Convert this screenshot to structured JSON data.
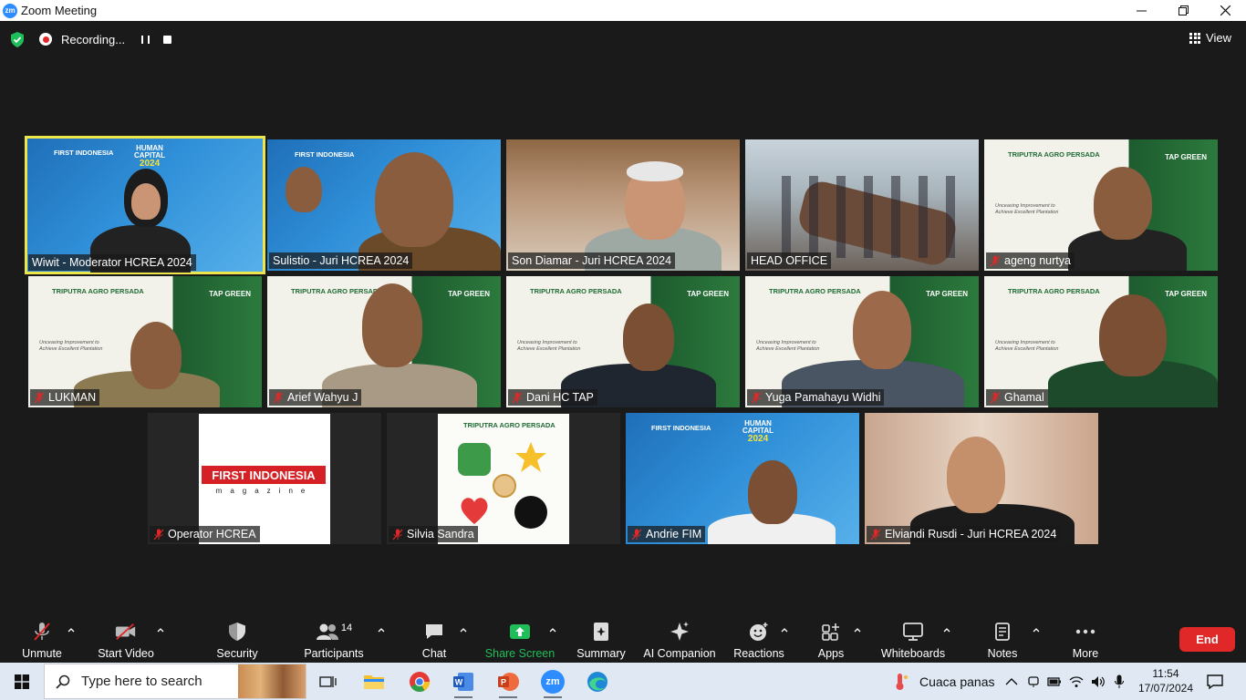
{
  "window": {
    "title": "Zoom Meeting",
    "logo_text": "zm",
    "controls": [
      "minimize-icon",
      "restore-icon",
      "close-icon"
    ]
  },
  "topbar": {
    "recording_label": "Recording...",
    "view_label": "View"
  },
  "participants": [
    {
      "name": "Wiwit - Moderator HCREA 2024",
      "muted": false,
      "active_speaker": true,
      "background": "human-capital-2024"
    },
    {
      "name": "Sulistio - Juri HCREA 2024",
      "muted": false,
      "background": "human-capital-2024"
    },
    {
      "name": "Son Diamar - Juri HCREA 2024",
      "muted": false,
      "background": "office"
    },
    {
      "name": "HEAD OFFICE",
      "muted": false,
      "background": "meeting-room"
    },
    {
      "name": "ageng nurtya",
      "muted": true,
      "background": "tap-green"
    },
    {
      "name": "LUKMAN",
      "muted": true,
      "background": "tap-green"
    },
    {
      "name": "Arief Wahyu J",
      "muted": true,
      "background": "tap-green"
    },
    {
      "name": "Dani HC TAP",
      "muted": true,
      "background": "tap-green"
    },
    {
      "name": "Yuga Pamahayu Widhi",
      "muted": true,
      "background": "tap-green"
    },
    {
      "name": "Ghamal",
      "muted": true,
      "background": "tap-green"
    },
    {
      "name": "Operator HCREA",
      "muted": true,
      "background": "first-indonesia-logo"
    },
    {
      "name": "Silvia Sandra",
      "muted": true,
      "background": "triputra-mascots"
    },
    {
      "name": "Andrie FIM",
      "muted": true,
      "background": "human-capital-2024"
    },
    {
      "name": "Elviandi Rusdi - Juri HCREA 2024",
      "muted": true,
      "background": "beige-room"
    }
  ],
  "backgrounds": {
    "hc_brand": "FIRST INDONESIA",
    "hc_logo_line1": "HUMAN",
    "hc_logo_line2": "CAPITAL",
    "hc_logo_year": "2024",
    "tap_brand": "TRIPUTRA AGRO PERSADA",
    "tap_green": "TAP GREEN",
    "tap_tagline": "Unceasing Improvement to Achieve Excellent Plantation",
    "first_indonesia": "FIRST INDONESIA",
    "magazine": "magazine"
  },
  "toolbar": {
    "unmute": "Unmute",
    "start_video": "Start Video",
    "security": "Security",
    "participants": "Participants",
    "participant_count": "14",
    "chat": "Chat",
    "share_screen": "Share Screen",
    "summary": "Summary",
    "ai_companion": "AI Companion",
    "reactions": "Reactions",
    "apps": "Apps",
    "whiteboards": "Whiteboards",
    "notes": "Notes",
    "more": "More",
    "end": "End"
  },
  "taskbar": {
    "search_placeholder": "Type here to search",
    "weather": "Cuaca panas",
    "time": "11:54",
    "date": "17/07/2024"
  },
  "colors": {
    "active_speaker": "#ede64a",
    "end_button": "#e02828",
    "share_screen": "#1fbe5a",
    "zoom_blue": "#2d8cff",
    "recording_red": "#e02828"
  }
}
